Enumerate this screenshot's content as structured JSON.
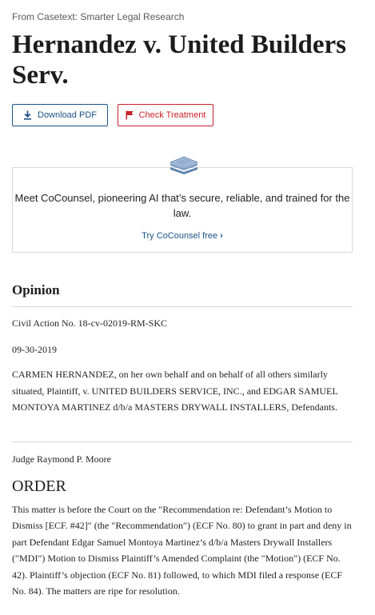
{
  "source": "From Casetext: Smarter Legal Research",
  "case_title": "Hernandez v. United Builders Serv.",
  "actions": {
    "download_label": "Download PDF",
    "treatment_label": "Check Treatment",
    "download_color": "#1b5286",
    "treatment_color": "#c8202a"
  },
  "promo": {
    "text": "Meet CoCounsel, pioneering AI that’s secure, reliable, and trained for the law.",
    "link_label": "Try CoCounsel free",
    "logo_icon": "stacked-layers-icon"
  },
  "opinion": {
    "heading": "Opinion",
    "civil_action": "Civil Action No. 18-cv-02019-RM-SKC",
    "date": "09-30-2019",
    "parties": "CARMEN HERNANDEZ, on her own behalf and on behalf of all others similarly situated, Plaintiff, v. UNITED BUILDERS SERVICE, INC., and EDGAR SAMUEL MONTOYA MARTINEZ d/b/a MASTERS DRYWALL INSTALLERS, Defendants.",
    "judge": "Judge Raymond P. Moore",
    "order_heading": "ORDER",
    "order_text": "This matter is before the Court on the ″Recommendation re: Defendant’s Motion to Dismiss [ECF. #42]″ (the ″Recommendation″) (ECF No. 80) to grant in part and deny in part Defendant Edgar Samuel Montoya Martinez’s d/b/a Masters Drywall Installers (″MDI″) Motion to Dismiss Plaintiff’s Amended Complaint (the ″Motion″) (ECF No. 42). Plaintiff’s objection (ECF No. 81) followed, to which MDI filed a response (ECF No. 84). The matters are ripe for resolution."
  }
}
